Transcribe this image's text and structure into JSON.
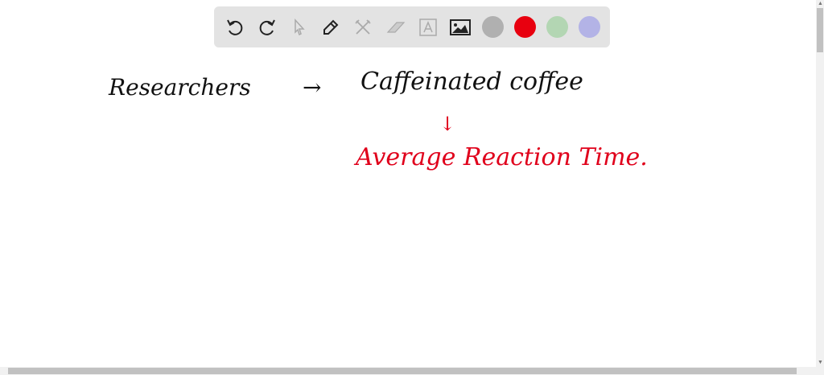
{
  "toolbar": {
    "tools": [
      "undo-icon",
      "redo-icon",
      "select-icon",
      "pen-icon",
      "tools-icon",
      "eraser-icon",
      "text-icon",
      "image-icon"
    ],
    "colors": [
      "#b0b0b0",
      "#e8000f",
      "#b3d6b3",
      "#b3b3e6"
    ]
  },
  "canvas": {
    "word1": "Researchers",
    "arrow1": "→",
    "word2": "Caffeinated coffee",
    "arrow2": "↓",
    "word3": "Average Reaction Time."
  }
}
